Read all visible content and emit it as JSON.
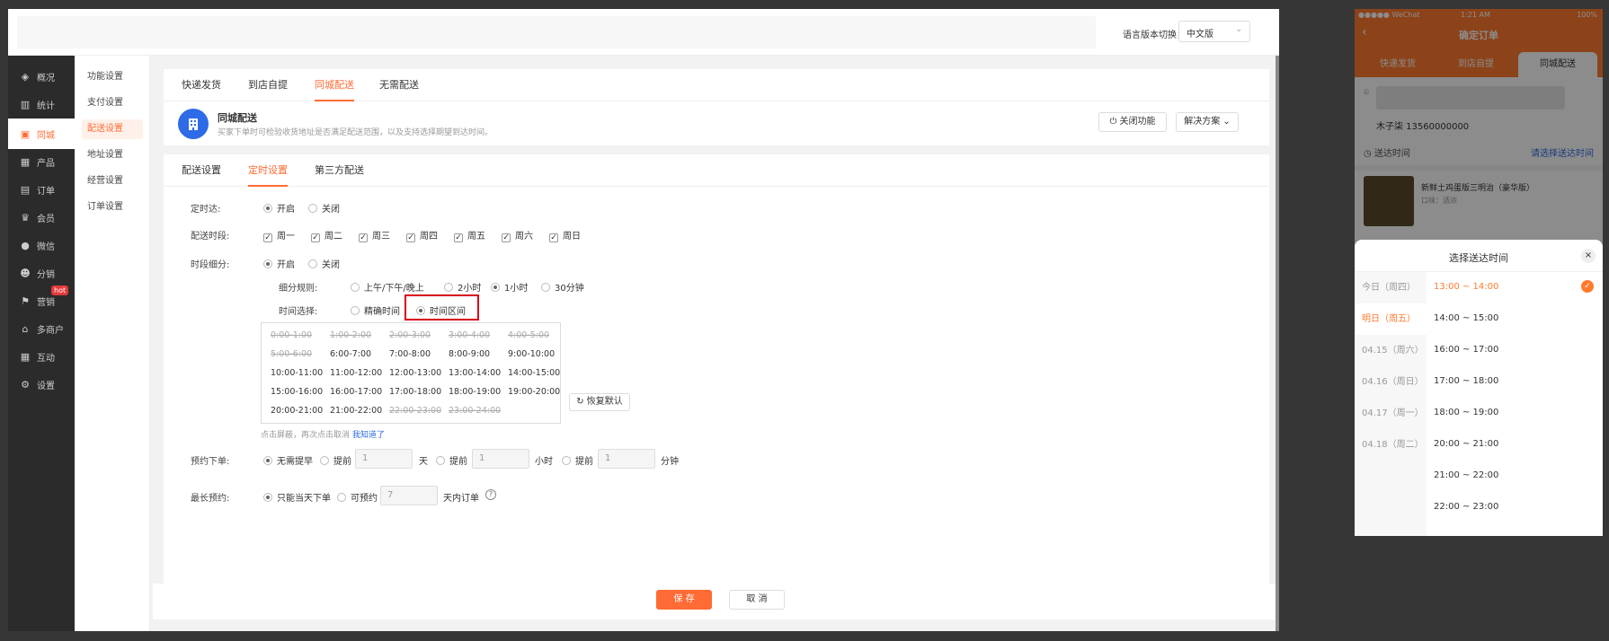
{
  "topbar": {
    "lang_label": "语言版本切换：",
    "lang_value": "中文版"
  },
  "nav1": [
    {
      "label": "概况",
      "icon": "layers-icon"
    },
    {
      "label": "统计",
      "icon": "chart-icon"
    },
    {
      "label": "同城",
      "icon": "store-icon"
    },
    {
      "label": "产品",
      "icon": "grid-icon"
    },
    {
      "label": "订单",
      "icon": "order-icon"
    },
    {
      "label": "会员",
      "icon": "crown-icon"
    },
    {
      "label": "微信",
      "icon": "wechat-icon"
    },
    {
      "label": "分销",
      "icon": "user-icon"
    },
    {
      "label": "营销",
      "icon": "flag-icon"
    },
    {
      "label": "多商户",
      "icon": "shop-icon"
    },
    {
      "label": "互动",
      "icon": "grid-icon"
    },
    {
      "label": "设置",
      "icon": "gear-icon"
    }
  ],
  "hot_badge": "hot",
  "nav2": [
    "功能设置",
    "支付设置",
    "配送设置",
    "地址设置",
    "经营设置",
    "订单设置"
  ],
  "top_tabs": [
    "快递发货",
    "到店自提",
    "同城配送",
    "无需配送"
  ],
  "header": {
    "title": "同城配送",
    "desc": "买家下单时可检验收货地址是否满足配送范围，以及支持选择期望到达时间。",
    "close_btn": "关闭功能",
    "solution_btn": "解决方案"
  },
  "sub_tabs": [
    "配送设置",
    "定时设置",
    "第三方配送"
  ],
  "form": {
    "timed_label": "定时达:",
    "on": "开启",
    "off": "关闭",
    "period_label": "配送时段:",
    "weekdays": [
      "周一",
      "周二",
      "周三",
      "周四",
      "周五",
      "周六",
      "周日"
    ],
    "split_label": "时段细分:",
    "rule_label": "细分规则:",
    "rules": [
      "上午/下午/晚上",
      "2小时",
      "1小时",
      "30分钟"
    ],
    "select_label": "时间选择:",
    "select_opts": [
      "精确时间",
      "时间区间"
    ],
    "slots": [
      [
        "0:00-1:00",
        "1:00-2:00",
        "2:00-3:00",
        "3:00-4:00",
        "4:00-5:00"
      ],
      [
        "5:00-6:00",
        "6:00-7:00",
        "7:00-8:00",
        "8:00-9:00",
        "9:00-10:00"
      ],
      [
        "10:00-11:00",
        "11:00-12:00",
        "12:00-13:00",
        "13:00-14:00",
        "14:00-15:00"
      ],
      [
        "15:00-16:00",
        "16:00-17:00",
        "17:00-18:00",
        "18:00-19:00",
        "19:00-20:00"
      ],
      [
        "20:00-21:00",
        "21:00-22:00",
        "22:00-23:00",
        "23:00-24:00"
      ]
    ],
    "restore_btn": "恢复默认",
    "hint": "点击屏蔽，再次点击取消",
    "hint_link": "我知道了",
    "advance_label": "预约下单:",
    "no_advance": "无需提早",
    "ahead": "提前",
    "advance_val": "1",
    "unit_day": "天",
    "unit_hour": "小时",
    "unit_min": "分钟",
    "max_label": "最长预约:",
    "same_day": "只能当天下单",
    "can_book": "可预约",
    "max_val": "7",
    "within": "天内订单"
  },
  "footer": {
    "save": "保 存",
    "cancel": "取 消"
  },
  "phone": {
    "status_left": "●●●●● WeChat",
    "status_time": "1:21 AM",
    "status_right": "100%",
    "nav_title": "确定订单",
    "tabs": [
      "快递发货",
      "到店自提",
      "同城配送"
    ],
    "contact": "木子柒  13560000000",
    "deliver_label": "送达时间",
    "deliver_value": "请选择送达时间",
    "product": "新鲜土鸡蛋版三明治（豪华版）",
    "product_sub": "口味：酒浓",
    "sheet_title": "选择送达时间",
    "days": [
      "今日（周四）",
      "明日（周五）",
      "04.15（周六）",
      "04.16（周日）",
      "04.17（周一）",
      "04.18（周二）"
    ],
    "times": [
      "13:00 ~ 14:00",
      "14:00 ~ 15:00",
      "16:00 ~ 17:00",
      "17:00 ~ 18:00",
      "18:00 ~ 19:00",
      "20:00 ~ 21:00",
      "21:00 ~ 22:00",
      "22:00 ~ 23:00"
    ]
  },
  "colors": {
    "accent": "#ff6b35",
    "sidebar": "#2b2b2b",
    "highlight": "#d9001b"
  }
}
